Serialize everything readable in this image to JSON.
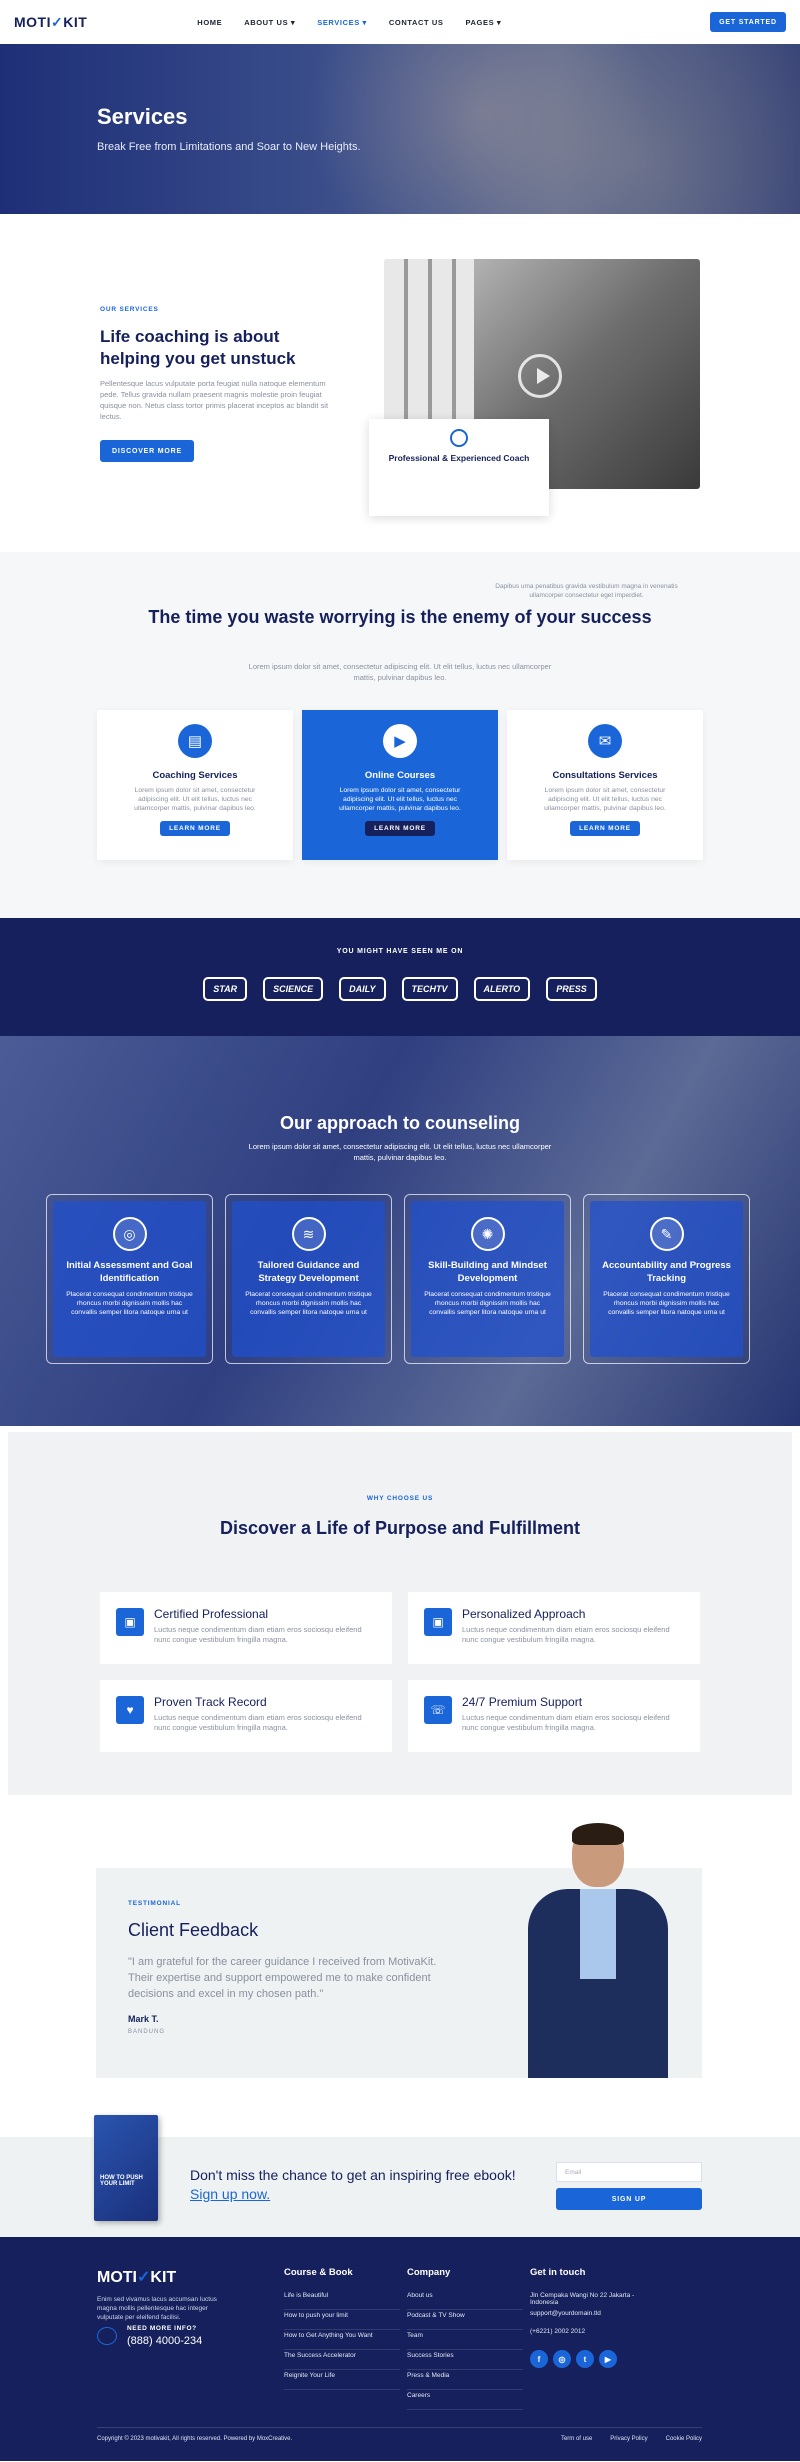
{
  "header": {
    "logo_a": "MOTI",
    "logo_b": "KIT",
    "nav": [
      "HOME",
      "ABOUT US ▾",
      "SERVICES ▾",
      "CONTACT US",
      "PAGES ▾"
    ],
    "cta": "GET STARTED"
  },
  "hero": {
    "title": "Services",
    "subtitle": "Break Free from Limitations and Soar to New Heights."
  },
  "about": {
    "kicker": "OUR SERVICES",
    "title": "Life coaching is about helping you get unstuck",
    "body": "Pellentesque lacus vulputate porta feugiat nulla natoque elementum pede. Tellus gravida nullam praesent magnis molestie proin feugiat quisque non. Netus class tortor primis placerat inceptos ac blandit sit lectus.",
    "cta": "DISCOVER MORE",
    "card_title": "Professional & Experienced Coach",
    "card_body": "Dapibus uma penatibus gravida vestibulum magna in venenatis ullamcorper consectetur eget imperdiet."
  },
  "waste": {
    "title": "The time you waste worrying is the enemy of your success",
    "body": "Lorem ipsum dolor sit amet, consectetur adipiscing elit. Ut elit tellus, luctus nec ullamcorper mattis, pulvinar dapibus leo.",
    "cards": [
      {
        "title": "Coaching Services",
        "body": "Lorem ipsum dolor sit amet, consectetur adipiscing elit. Ut elit tellus, luctus nec ullamcorper mattis, pulvinar dapibus leo.",
        "cta": "LEARN MORE"
      },
      {
        "title": "Online Courses",
        "body": "Lorem ipsum dolor sit amet, consectetur adipiscing elit. Ut elit tellus, luctus nec ullamcorper mattis, pulvinar dapibus leo.",
        "cta": "LEARN MORE"
      },
      {
        "title": "Consultations Services",
        "body": "Lorem ipsum dolor sit amet, consectetur adipiscing elit. Ut elit tellus, luctus nec ullamcorper mattis, pulvinar dapibus leo.",
        "cta": "LEARN MORE"
      }
    ]
  },
  "seen": {
    "title": "YOU MIGHT HAVE SEEN ME ON",
    "logos": [
      "STAR",
      "SCIENCE",
      "DAILY",
      "TECHTV",
      "ALERTO",
      "PRESS"
    ]
  },
  "approach": {
    "title": "Our approach to counseling",
    "body": "Lorem ipsum dolor sit amet, consectetur adipiscing elit. Ut elit tellus, luctus nec ullamcorper mattis, pulvinar dapibus leo.",
    "cards": [
      {
        "title": "Initial Assessment and Goal Identification",
        "body": "Placerat consequat condimentum tristique rhoncus morbi dignissim mollis hac convallis semper litora natoque urna ut"
      },
      {
        "title": "Tailored Guidance and Strategy Development",
        "body": "Placerat consequat condimentum tristique rhoncus morbi dignissim mollis hac convallis semper litora natoque urna ut"
      },
      {
        "title": "Skill-Building and Mindset Development",
        "body": "Placerat consequat condimentum tristique rhoncus morbi dignissim mollis hac convallis semper litora natoque urna ut"
      },
      {
        "title": "Accountability and Progress Tracking",
        "body": "Placerat consequat condimentum tristique rhoncus morbi dignissim mollis hac convallis semper litora natoque urna ut"
      }
    ]
  },
  "why": {
    "kicker": "WHY CHOOSE US",
    "title": "Discover a Life of Purpose and Fulfillment",
    "cards": [
      {
        "title": "Certified Professional",
        "body": "Luctus neque condimentum diam etiam eros sociosqu eleifend nunc congue vestibulum fringilla magna."
      },
      {
        "title": "Personalized Approach",
        "body": "Luctus neque condimentum diam etiam eros sociosqu eleifend nunc congue vestibulum fringilla magna."
      },
      {
        "title": "Proven Track Record",
        "body": "Luctus neque condimentum diam etiam eros sociosqu eleifend nunc congue vestibulum fringilla magna."
      },
      {
        "title": "24/7 Premium Support",
        "body": "Luctus neque condimentum diam etiam eros sociosqu eleifend nunc congue vestibulum fringilla magna."
      }
    ]
  },
  "testimonial": {
    "kicker": "TESTIMONIAL",
    "title": "Client Feedback",
    "quote": "\"I am grateful for the career guidance I received from MotivaKit. Their expertise and support empowered me to make confident decisions and excel in my chosen path.\"",
    "name": "Mark T.",
    "location": "BANDUNG"
  },
  "ebook": {
    "book_title": "HOW TO PUSH YOUR LIMIT",
    "title": "Don't miss the chance to get an inspiring free ebook!",
    "link": "Sign up now.",
    "email_placeholder": "Email",
    "cta": "SIGN UP"
  },
  "footer": {
    "desc": "Enim sed vivamus lacus accumsan luctus magna mollis pellentesque hac integer vulputate per eleifend facilisi.",
    "need": "NEED MORE INFO?",
    "phone": "(888) 4000-234",
    "col1": {
      "title": "Course & Book",
      "items": [
        "Life is Beautiful",
        "How to push your limit",
        "How to Get Anything You Want",
        "The Success Accelerator",
        "Reignite Your Life"
      ]
    },
    "col2": {
      "title": "Company",
      "items": [
        "About us",
        "Podcast & TV Show",
        "Team",
        "Success Stories",
        "Press & Media",
        "Careers"
      ]
    },
    "col3": {
      "title": "Get in touch",
      "items": [
        "Jln Cempaka Wangi No 22 Jakarta - Indonesia",
        "support@yourdomain.tld",
        "(+6221) 2002 2012"
      ]
    },
    "social": [
      "f",
      "◎",
      "t",
      "▶"
    ],
    "copyright": "Copyright © 2023 motivakit, All rights reserved. Powered by MoxCreative.",
    "legal": [
      "Term of use",
      "Privacy Policy",
      "Cookie Policy"
    ]
  },
  "colors": {
    "accent": "#1a66d9",
    "navy": "#15205c"
  }
}
